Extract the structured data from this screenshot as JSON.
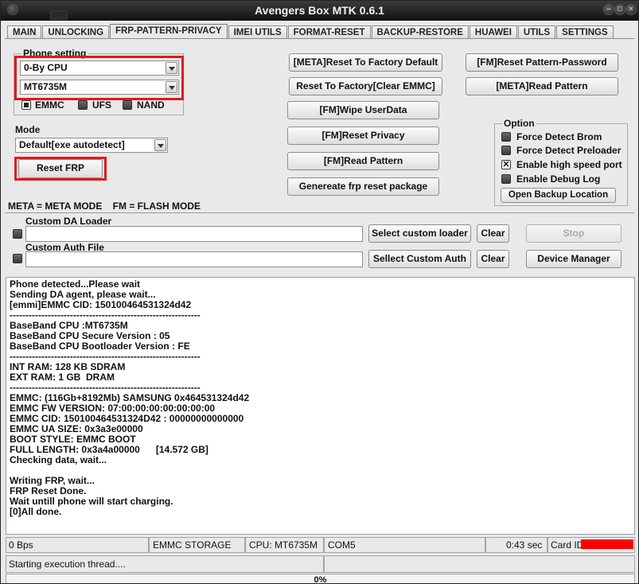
{
  "window": {
    "title": "Avengers Box MTK 0.6.1"
  },
  "tabs": [
    {
      "label": "MAIN"
    },
    {
      "label": "UNLOCKING"
    },
    {
      "label": "FRP-PATTERN-PRIVACY",
      "active": true
    },
    {
      "label": "IMEI UTILS"
    },
    {
      "label": "FORMAT-RESET"
    },
    {
      "label": "BACKUP-RESTORE"
    },
    {
      "label": "HUAWEI"
    },
    {
      "label": "UTILS"
    },
    {
      "label": "SETTINGS"
    }
  ],
  "phone_setting": {
    "title": "Phone setting",
    "cpu_select": "0-By CPU",
    "model_select": "MT6735M",
    "storage_options": [
      {
        "label": "EMMC",
        "selected": true
      },
      {
        "label": "UFS",
        "selected": false
      },
      {
        "label": "NAND",
        "selected": false
      }
    ]
  },
  "mode": {
    "label": "Mode",
    "select": "Default[exe autodetect]"
  },
  "reset_frp_label": "Reset FRP",
  "legend_text": "META = META MODE    FM = FLASH MODE",
  "actions": {
    "meta_reset_factory": "[META]Reset To Factory Default",
    "reset_factory_clear": "Reset To Factory[Clear EMMC]",
    "fm_wipe_userdata": "[FM]Wipe UserData",
    "fm_reset_privacy": "[FM]Reset Privacy",
    "fm_read_pattern": "[FM]Read Pattern",
    "generate_frp_package": "Genereate frp reset package",
    "fm_reset_pattern_password": "[FM]Reset Pattern-Password",
    "meta_read_pattern": "[META]Read Pattern"
  },
  "option": {
    "title": "Option",
    "items": [
      {
        "label": "Force Detect Brom",
        "checked": false
      },
      {
        "label": "Force Detect Preloader",
        "checked": false
      },
      {
        "label": "Enable high speed port",
        "checked": true
      },
      {
        "label": "Enable Debug Log",
        "checked": false
      }
    ],
    "open_backup_label": "Open Backup Location"
  },
  "loader": {
    "custom_da_label": "Custom DA Loader",
    "custom_da_value": "",
    "select_custom_loader": "Select custom loader",
    "clear1": "Clear",
    "custom_auth_label": "Custom Auth File",
    "custom_auth_value": "",
    "select_custom_auth": "Sellect Custom Auth",
    "clear2": "Clear",
    "stop": "Stop",
    "device_manager": "Device Manager"
  },
  "log": [
    "Phone detected...Please wait",
    "Sending DA agent, please wait...",
    "[emmi]EMMC CID: 150100464531324d42",
    "------------------------------------------------------------",
    "BaseBand CPU :MT6735M",
    "BaseBand CPU Secure Version : 05",
    "BaseBand CPU Bootloader Version : FE",
    "------------------------------------------------------------",
    "INT RAM: 128 KB SDRAM",
    "EXT RAM: 1 GB  DRAM",
    "------------------------------------------------------------",
    "EMMC: (116Gb+8192Mb) SAMSUNG 0x464531324d42",
    "EMMC FW VERSION: 07:00:00:00:00:00:00:00",
    "EMMC CID: 150100464531324D42 : 00000000000000",
    "EMMC UA SIZE: 0x3a3e00000",
    "BOOT STYLE: EMMC BOOT",
    "FULL LENGTH: 0x3a4a00000      [14.572 GB]",
    "Checking data, wait...",
    "",
    "Writing FRP, wait...",
    "FRP Reset Done.",
    "Wait untill phone will start charging.",
    "[0]All done."
  ],
  "status": {
    "speed": "0 Bps",
    "storage": "EMMC STORAGE",
    "cpu": "CPU: MT6735M",
    "port": "COM5",
    "time": "0:43 sec",
    "card_id": "Card ID",
    "thread": "Starting execution thread....",
    "progress_text": "0%",
    "progress_value": 0
  },
  "colors": {
    "highlight_box": "#e0191a",
    "card_redaction": "#ff0000"
  }
}
